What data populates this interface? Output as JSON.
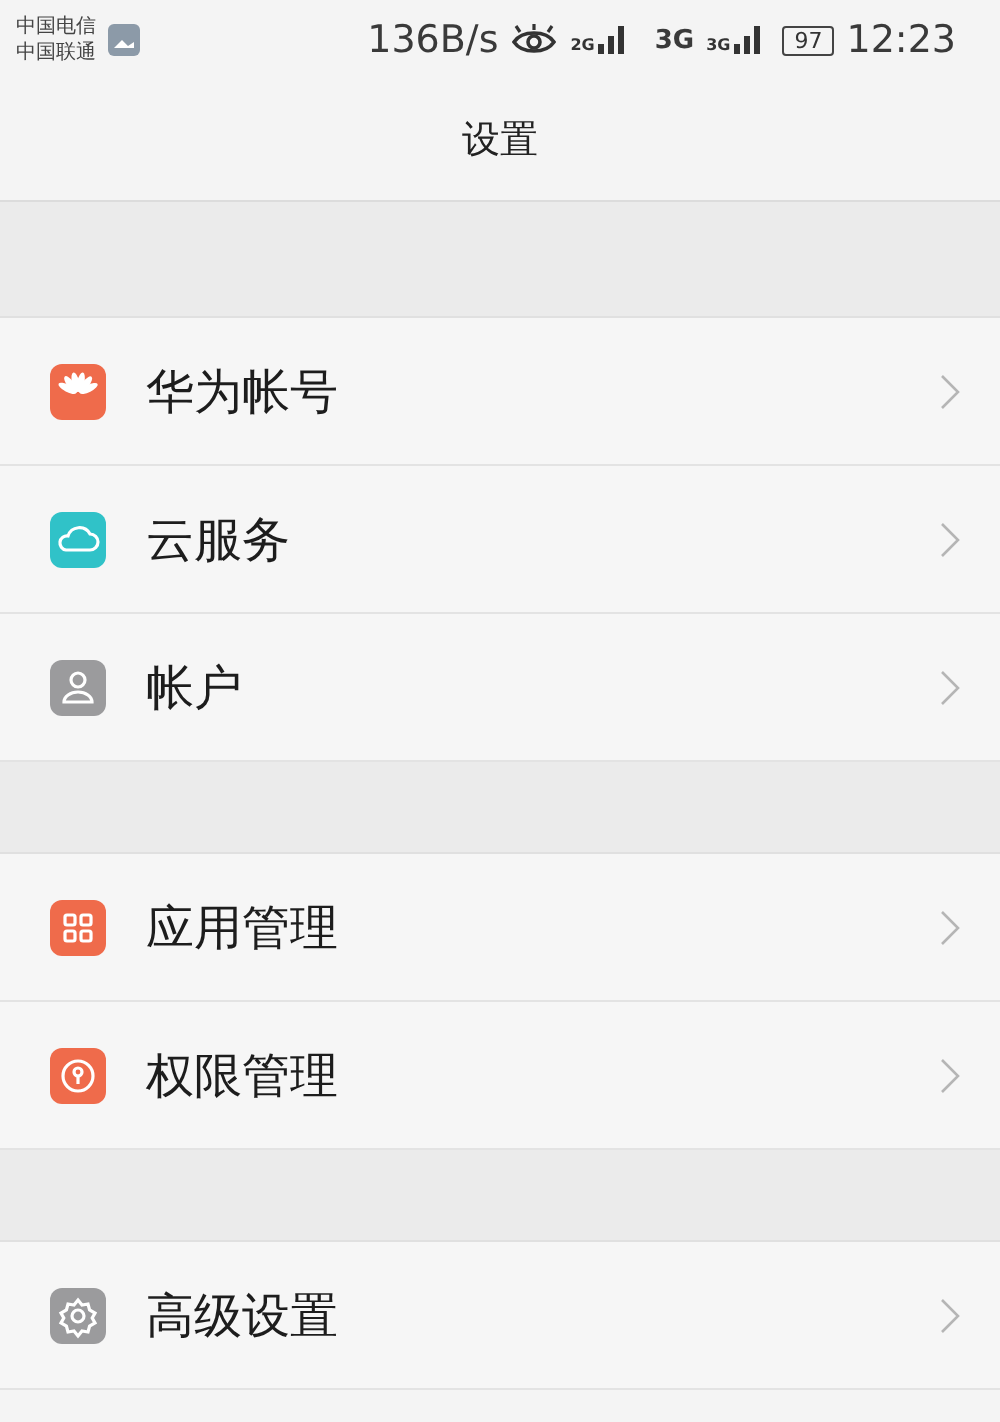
{
  "status_bar": {
    "carriers": [
      "中国电信",
      "中国联通"
    ],
    "speed": "136B/s",
    "sim1_network": "2G",
    "data_network": "3G",
    "sim2_network": "3G",
    "battery": "97",
    "time": "12:23"
  },
  "title": "设置",
  "sections": [
    {
      "items": [
        {
          "label": "华为帐号",
          "kind": "huawei",
          "color": "#ef6b4b"
        },
        {
          "label": "云服务",
          "kind": "cloud",
          "color": "#30c2c8"
        },
        {
          "label": "帐户",
          "kind": "person",
          "color": "#9b9b9d"
        }
      ]
    },
    {
      "items": [
        {
          "label": "应用管理",
          "kind": "grid",
          "color": "#ef6b4b"
        },
        {
          "label": "权限管理",
          "kind": "lock",
          "color": "#ef6b4b"
        }
      ]
    },
    {
      "items": [
        {
          "label": "高级设置",
          "kind": "gear",
          "color": "#9b9b9d"
        }
      ]
    }
  ]
}
